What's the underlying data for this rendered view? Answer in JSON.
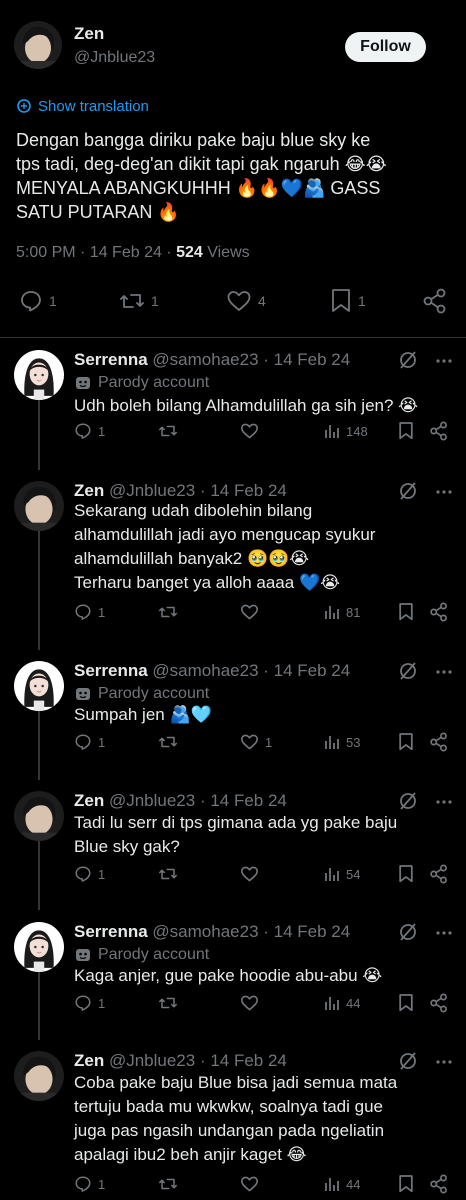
{
  "main_tweet": {
    "author_name": "Zen",
    "author_handle": "@Jnblue23",
    "follow_label": "Follow",
    "translate_label": "Show translation",
    "text_lines": [
      "Dengan bangga diriku pake baju blue sky ke",
      "tps tadi, deg-deg'an dikit tapi gak ngaruh 😂😭",
      "MENYALA ABANGKUHHH 🔥🔥💙🫂 GASS",
      "SATU PUTARAN 🔥"
    ],
    "time": "5:00 PM · 14 Feb 24 · ",
    "views_count": "524",
    "views_label": " Views",
    "actions": {
      "replies": "1",
      "reposts": "1",
      "likes": "4",
      "bookmarks": "1"
    }
  },
  "replies": [
    {
      "name": "Serrenna",
      "handle": " @samohae23 · 14 Feb 24",
      "parody": "Parody account",
      "lines": [
        "Udh boleh bilang Alhamdulillah ga sih jen? 😭"
      ],
      "replies": "1",
      "reposts": "",
      "likes": "",
      "views": "148"
    },
    {
      "name": "Zen",
      "handle": " @Jnblue23 · 14 Feb 24",
      "parody": "",
      "lines": [
        "Sekarang udah dibolehin bilang",
        "alhamdulillah jadi ayo mengucap syukur",
        "alhamdulillah banyak2 🥹🥹😭",
        "Terharu banget ya alloh aaaa 💙😭"
      ],
      "replies": "1",
      "reposts": "",
      "likes": "",
      "views": "81"
    },
    {
      "name": "Serrenna",
      "handle": " @samohae23 · 14 Feb 24",
      "parody": "Parody account",
      "lines": [
        "Sumpah jen 🫂🩵"
      ],
      "replies": "1",
      "reposts": "",
      "likes": "1",
      "views": "53"
    },
    {
      "name": "Zen",
      "handle": " @Jnblue23 · 14 Feb 24",
      "parody": "",
      "lines": [
        "Tadi lu serr di tps gimana ada yg pake baju",
        "Blue sky gak?"
      ],
      "replies": "1",
      "reposts": "",
      "likes": "",
      "views": "54"
    },
    {
      "name": "Serrenna",
      "handle": " @samohae23 · 14 Feb 24",
      "parody": "Parody account",
      "lines": [
        "Kaga anjer, gue pake hoodie abu-abu 😭"
      ],
      "replies": "1",
      "reposts": "",
      "likes": "",
      "views": "44"
    },
    {
      "name": "Zen",
      "handle": " @Jnblue23 · 14 Feb 24",
      "parody": "",
      "lines": [
        "Coba pake baju Blue bisa jadi semua mata",
        "tertuju bada mu wkwkw, soalnya tadi gue",
        "juga pas ngasih undangan pada ngeliatin",
        "apalagi ibu2 beh anjir kaget 😂"
      ],
      "replies": "1",
      "reposts": "",
      "likes": "",
      "views": "44"
    }
  ],
  "icons": {
    "reply": "reply-icon",
    "repost": "repost-icon",
    "like": "heart-icon",
    "views": "views-icon",
    "bookmark": "bookmark-icon",
    "share": "share-icon",
    "grok": "grok-icon",
    "translate": "translate-icon",
    "parody": "parody-mask-icon"
  },
  "colors": {
    "background": "#000000",
    "text": "#e7e9ea",
    "secondary": "#71767b",
    "link": "#1d9bf0",
    "follow_bg": "#eff3f4"
  }
}
